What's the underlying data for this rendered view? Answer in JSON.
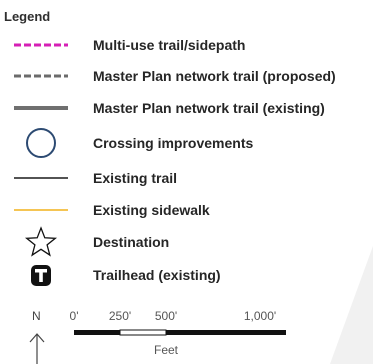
{
  "legend": {
    "title": "Legend",
    "items": [
      {
        "symbol": "magenta-dashed-line",
        "label": "Multi-use trail/sidepath"
      },
      {
        "symbol": "gray-dashed-line",
        "label": "Master Plan network trail (proposed)"
      },
      {
        "symbol": "gray-solid-line",
        "label": "Master Plan network trail (existing)"
      },
      {
        "symbol": "blue-circle",
        "label": "Crossing improvements"
      },
      {
        "symbol": "black-thin-line",
        "label": "Existing trail"
      },
      {
        "symbol": "orange-thin-line",
        "label": "Existing sidewalk"
      },
      {
        "symbol": "star-outline-icon",
        "label": "Destination"
      },
      {
        "symbol": "trailhead-t-icon",
        "label": "Trailhead (existing)"
      }
    ]
  },
  "north_arrow": {
    "letter": "N"
  },
  "scale_bar": {
    "ticks": [
      "0'",
      "250'",
      "500'",
      "1,000'"
    ],
    "unit": "Feet"
  },
  "colors": {
    "multi_use": "#d51fb5",
    "network_proposed": "#6b6b6b",
    "network_existing": "#6f6f6f",
    "crossing": "#2c4a72",
    "existing_trail": "#1a1a1a",
    "existing_sidewalk": "#f2b21b",
    "icon": "#111111"
  }
}
